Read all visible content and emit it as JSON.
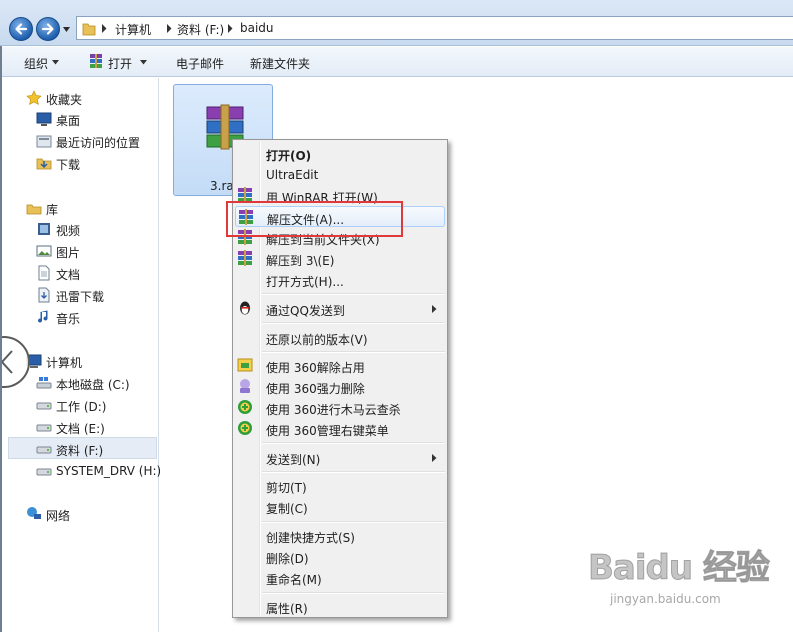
{
  "address_bar": {
    "crumbs": [
      "计算机",
      "资料 (F:)",
      "baidu"
    ]
  },
  "toolbar": {
    "organize_label": "组织",
    "open_label": "打开",
    "email_label": "电子邮件",
    "new_folder_label": "新建文件夹"
  },
  "nav": {
    "favorites": "收藏夹",
    "desktop": "桌面",
    "recent": "最近访问的位置",
    "downloads": "下载",
    "libraries": "库",
    "videos": "视频",
    "pictures": "图片",
    "documents": "文档",
    "xunlei": "迅雷下载",
    "music": "音乐",
    "computer": "计算机",
    "drive_c": "本地磁盘 (C:)",
    "drive_d": "工作 (D:)",
    "drive_e": "文档 (E:)",
    "drive_f": "资料 (F:)",
    "drive_h": "SYSTEM_DRV (H:)",
    "network": "网络"
  },
  "file": {
    "name": "3.ra"
  },
  "context_menu": {
    "items": [
      "打开(O)",
      "UltraEdit",
      "用 WinRAR 打开(W)",
      "解压文件(A)...",
      "解压到当前文件夹(X)",
      "解压到 3\\(E)",
      "打开方式(H)...",
      "通过QQ发送到",
      "还原以前的版本(V)",
      "使用 360解除占用",
      "使用 360强力删除",
      "使用 360进行木马云查杀",
      "使用 360管理右键菜单",
      "发送到(N)",
      "剪切(T)",
      "复制(C)",
      "创建快捷方式(S)",
      "删除(D)",
      "重命名(M)",
      "属性(R)"
    ]
  },
  "watermark": {
    "logo": "Baidu 经验",
    "url": "jingyan.baidu.com"
  },
  "colors": {
    "highlight": "#e0393c",
    "selection": "#c4dcf7"
  }
}
